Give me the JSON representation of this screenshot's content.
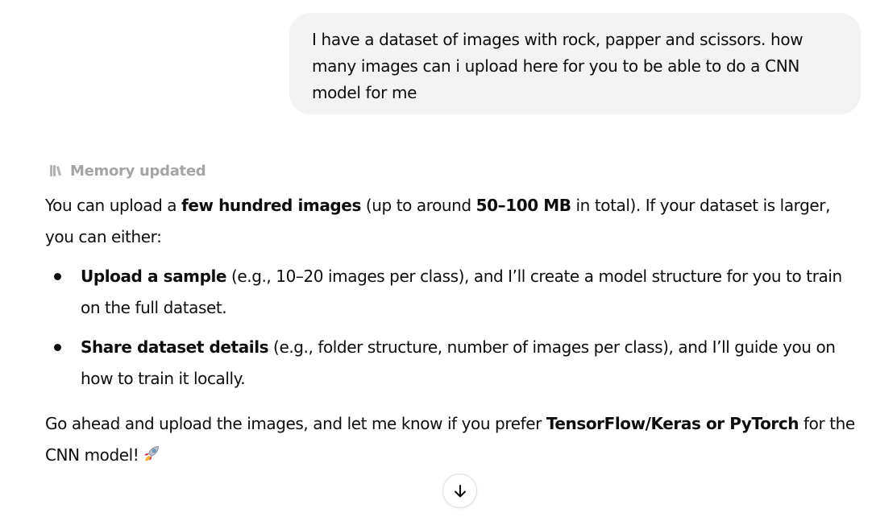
{
  "user_message": {
    "text": "I have a dataset of images with rock, papper and scissors. how many images can i upload here for you to be able to do a CNN model for me"
  },
  "memory_status": {
    "icon": "memory-icon",
    "label": "Memory updated"
  },
  "assistant_message": {
    "intro": {
      "t1": "You can upload a ",
      "b1": "few hundred images",
      "t2": " (up to around ",
      "b2": "50–100 MB",
      "t3": " in total). If your dataset is larger, you can either:"
    },
    "bullets": [
      {
        "bold": "Upload a sample",
        "text": " (e.g., 10–20 images per class), and I’ll create a model structure for you to train on the full dataset."
      },
      {
        "bold": "Share dataset details",
        "text": " (e.g., folder structure, number of images per class), and I’ll guide you on how to train it locally."
      }
    ],
    "closing": {
      "t1": "Go ahead and upload the images, and let me know if you prefer ",
      "b1": "TensorFlow/Keras or PyTorch",
      "t2": " for the CNN model!",
      "emoji": "rocket-icon"
    }
  },
  "scroll_button": {
    "icon": "arrow-down-icon"
  },
  "colors": {
    "bubble_bg": "#f3f3f3",
    "text": "#0d0d0d",
    "muted": "#a5a5a5",
    "background": "#ffffff"
  }
}
